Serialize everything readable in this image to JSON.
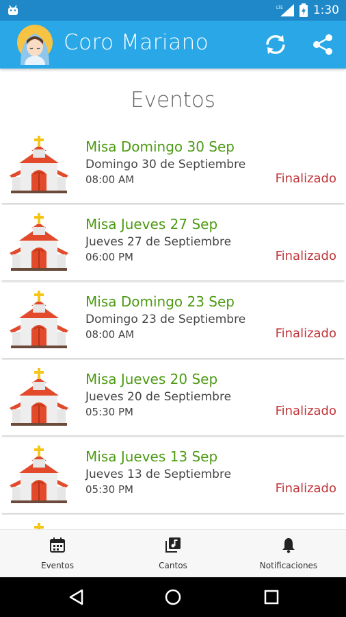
{
  "status_bar": {
    "time": "1:30",
    "network": "LTE",
    "icons": [
      "android-icon",
      "lte-signal-icon",
      "battery-icon"
    ]
  },
  "app_bar": {
    "title": "Coro Mariano",
    "logo": "virgin-mary-avatar",
    "actions": [
      "sync-icon",
      "share-icon"
    ]
  },
  "section": {
    "title": "Eventos"
  },
  "events": [
    {
      "name": "Misa Domingo 30 Sep",
      "date": "Domingo 30 de Septiembre",
      "time": "08:00 AM",
      "status": "Finalizado"
    },
    {
      "name": "Misa Jueves 27 Sep",
      "date": "Jueves 27 de Septiembre",
      "time": "06:00 PM",
      "status": "Finalizado"
    },
    {
      "name": "Misa Domingo 23 Sep",
      "date": "Domingo 23 de Septiembre",
      "time": "08:00 AM",
      "status": "Finalizado"
    },
    {
      "name": "Misa Jueves 20 Sep",
      "date": "Jueves 20 de Septiembre",
      "time": "05:30 PM",
      "status": "Finalizado"
    },
    {
      "name": "Misa Jueves 13 Sep",
      "date": "Jueves 13 de Septiembre",
      "time": "05:30 PM",
      "status": "Finalizado"
    }
  ],
  "bottom_nav": {
    "items": [
      {
        "label": "Eventos",
        "icon": "calendar-icon"
      },
      {
        "label": "Cantos",
        "icon": "music-library-icon"
      },
      {
        "label": "Notificaciones",
        "icon": "bell-icon"
      }
    ]
  },
  "system_nav": [
    "back-icon",
    "home-icon",
    "recents-icon"
  ],
  "colors": {
    "status_bar": "#1e88c9",
    "app_bar": "#29a7e6",
    "event_name": "#4c9a12",
    "status_finalizado": "#c0353a"
  }
}
